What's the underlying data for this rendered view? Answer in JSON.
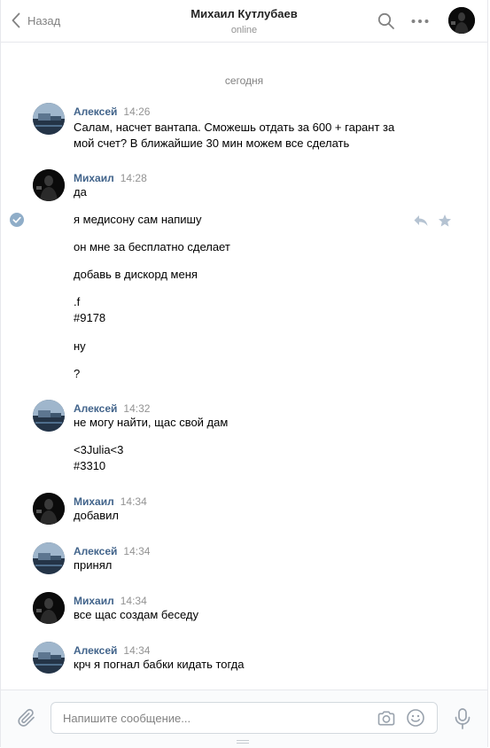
{
  "header": {
    "back_label": "Назад",
    "title": "Михаил Кутлубаев",
    "status": "online"
  },
  "feed": {
    "date_separator": "сегодня",
    "messages": [
      {
        "author": "Алексей",
        "time": "14:26",
        "lines": [
          "Салам, насчет вантапа. Сможешь отдать за 600 + гарант за",
          "мой счет? В ближайшие 30 мин можем все сделать"
        ]
      },
      {
        "author": "Михаил",
        "time": "14:28",
        "lines": [
          "да",
          "я медисону сам напишу",
          "он мне за бесплатно сделает",
          "добавь в дискорд меня",
          ".f",
          "#9178",
          "ну",
          "?"
        ]
      },
      {
        "author": "Алексей",
        "time": "14:32",
        "lines": [
          "не могу найти, щас свой дам",
          "<3Julia<3",
          "#3310"
        ]
      },
      {
        "author": "Михаил",
        "time": "14:34",
        "lines": [
          "добавил"
        ]
      },
      {
        "author": "Алексей",
        "time": "14:34",
        "lines": [
          "принял"
        ]
      },
      {
        "author": "Михаил",
        "time": "14:34",
        "lines": [
          "все щас создам беседу"
        ]
      },
      {
        "author": "Алексей",
        "time": "14:34",
        "lines": [
          "крч я погнал бабки кидать тогда"
        ]
      }
    ]
  },
  "composer": {
    "placeholder": "Напишите сообщение..."
  },
  "colors": {
    "author_link": "#42648b",
    "muted": "#939393",
    "accent_blue": "#8fadc8"
  }
}
